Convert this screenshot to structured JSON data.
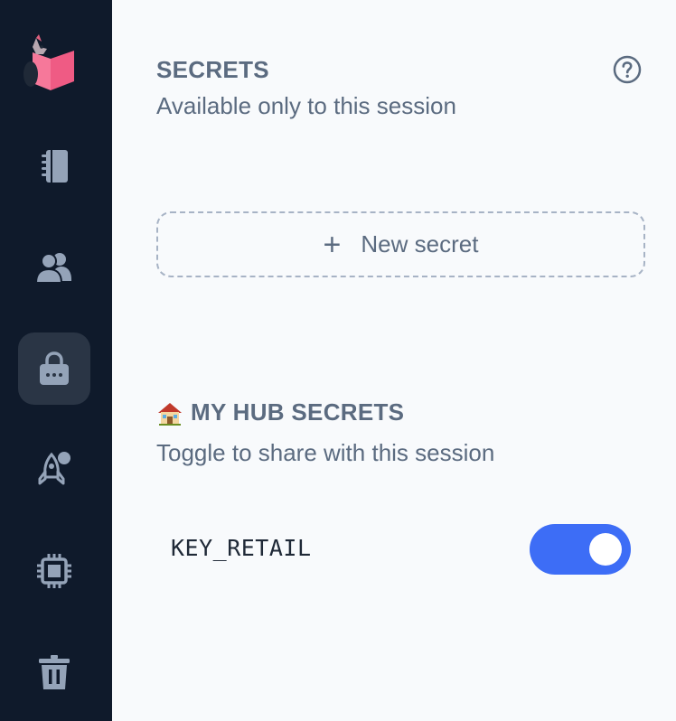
{
  "sidebar": {
    "items": [
      {
        "name": "notebook",
        "icon": "notebook-icon",
        "active": false
      },
      {
        "name": "users",
        "icon": "users-icon",
        "active": false
      },
      {
        "name": "secrets",
        "icon": "lock-icon",
        "active": true
      },
      {
        "name": "launch",
        "icon": "rocket-icon",
        "active": false
      },
      {
        "name": "processor",
        "icon": "chip-icon",
        "active": false
      },
      {
        "name": "trash",
        "icon": "trash-icon",
        "active": false
      }
    ],
    "background": "#0f1a2b",
    "active_background": "#2a3545",
    "icon_color": "#94a3b8"
  },
  "secrets": {
    "title": "SECRETS",
    "subtitle": "Available only to this session",
    "help_icon": "question-circle-icon",
    "new_secret_label": "New secret",
    "new_secret_icon": "plus-icon"
  },
  "hub": {
    "title": "MY HUB SECRETS",
    "title_icon": "house-icon",
    "subtitle": "Toggle to share with this session",
    "items": [
      {
        "name": "KEY_RETAIL",
        "enabled": true
      }
    ]
  },
  "colors": {
    "text": "#5b6b80",
    "toggle_on": "#3d6df6",
    "background": "#f8fafc"
  }
}
